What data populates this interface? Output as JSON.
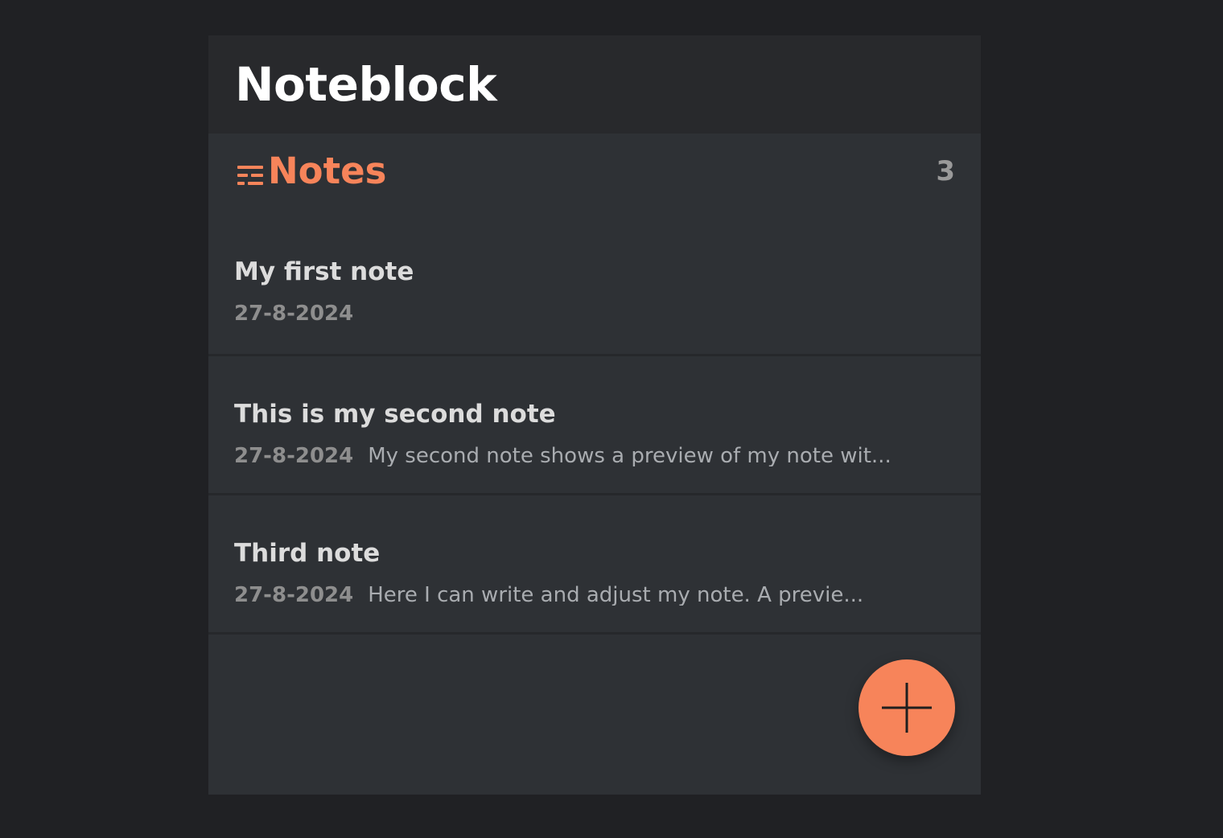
{
  "app": {
    "title": "Noteblock"
  },
  "section": {
    "title": "Notes",
    "icon": "list-icon",
    "count": "3"
  },
  "notes": [
    {
      "title": "My first note",
      "date": "27-8-2024",
      "preview": ""
    },
    {
      "title": "This is my second note",
      "date": "27-8-2024",
      "preview": "My second note shows a preview of my note wit..."
    },
    {
      "title": "Third note",
      "date": "27-8-2024",
      "preview": "Here I can write and adjust my note. A previe..."
    }
  ],
  "fab": {
    "icon": "plus-icon"
  },
  "colors": {
    "accent": "#f7845a",
    "background": "#202124",
    "panel": "#2e3135",
    "header": "#28292c"
  }
}
